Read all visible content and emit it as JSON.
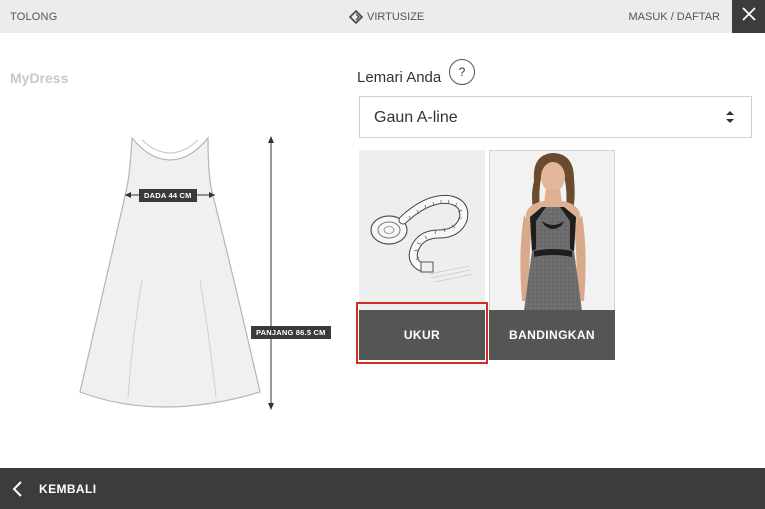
{
  "topbar": {
    "help_label": "TOLONG",
    "brand_label": "VIRTUSIZE",
    "login_label": "MASUK / DAFTAR"
  },
  "left": {
    "title": "MyDress",
    "bust_label": "DADA 44 CM",
    "length_label": "PANJANG 86.5 CM"
  },
  "right": {
    "wardrobe_title": "Lemari Anda",
    "help_symbol": "?",
    "select_value": "Gaun A-line",
    "measure_button": "UKUR",
    "compare_button": "BANDINGKAN"
  },
  "bottombar": {
    "back_label": "KEMBALI"
  },
  "colors": {
    "dark_bar": "#3c3c3c",
    "button_gray": "#555555",
    "focus_red": "#d42a2a",
    "topbar_bg": "#ececec"
  },
  "icons": {
    "brand": "virtusize-logo-icon",
    "close": "close-icon",
    "help": "question-mark-icon",
    "select": "sort-arrows-icon",
    "back": "chevron-left-icon",
    "measure": "measuring-tape-icon"
  }
}
